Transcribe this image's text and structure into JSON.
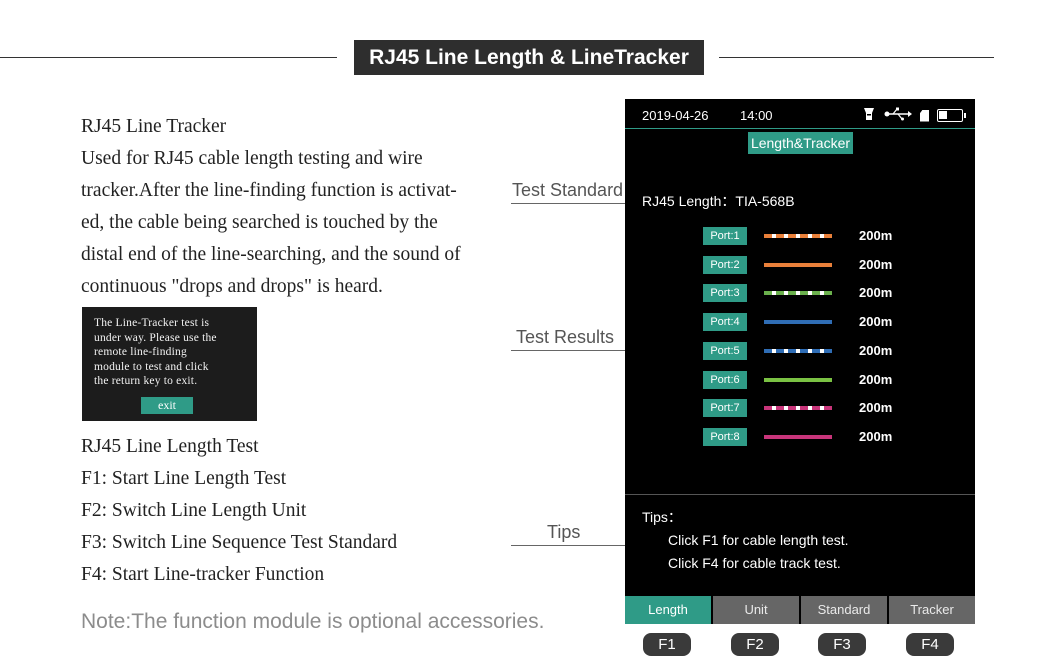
{
  "header": {
    "title": "RJ45 Line Length & LineTracker"
  },
  "description": {
    "lines": [
      "RJ45 Line Tracker",
      "Used for RJ45 cable length testing and wire",
      "tracker.After the line-finding function is activat-",
      "ed, the cable being searched is touched by the",
      "distal end of the line-searching, and the sound of",
      "continuous \"drops and drops\" is heard."
    ]
  },
  "popup": {
    "text": "The Line-Tracker test is\nunder way. Please use the\nremote line-finding\nmodule to test and click\nthe return key to exit.",
    "exit_label": "exit"
  },
  "functions": {
    "lines": [
      "RJ45 Line Length Test",
      "F1: Start Line Length Test",
      "F2: Switch Line Length Unit",
      "F3: Switch Line Sequence Test Standard",
      "F4: Start Line-tracker Function"
    ]
  },
  "note": "Note:The function module is optional accessories.",
  "callouts": {
    "standard": "Test Standard",
    "results": "Test Results",
    "tips": "Tips"
  },
  "screen": {
    "date": "2019-04-26",
    "time": "14:00",
    "icons": [
      "flashlight-icon",
      "usb-icon",
      "sd-card-icon",
      "battery-icon"
    ],
    "battery_level": 0.4,
    "mode_title": "Length&Tracker",
    "standard": "RJ45 Length：TIA-568B",
    "ports": [
      {
        "label": "Port:1",
        "length": "200m",
        "color": "#e9803a",
        "striped": true
      },
      {
        "label": "Port:2",
        "length": "200m",
        "color": "#e9803a",
        "striped": false
      },
      {
        "label": "Port:3",
        "length": "200m",
        "color": "#6ab04c",
        "striped": true
      },
      {
        "label": "Port:4",
        "length": "200m",
        "color": "#2f6db5",
        "striped": false
      },
      {
        "label": "Port:5",
        "length": "200m",
        "color": "#2f6db5",
        "striped": true
      },
      {
        "label": "Port:6",
        "length": "200m",
        "color": "#7ac143",
        "striped": false
      },
      {
        "label": "Port:7",
        "length": "200m",
        "color": "#c8357a",
        "striped": true
      },
      {
        "label": "Port:8",
        "length": "200m",
        "color": "#c8357a",
        "striped": false
      }
    ],
    "tips_heading": "Tips：",
    "tips": [
      "Click F1 for cable length test.",
      "Click F4 for cable track test."
    ],
    "softkeys": [
      "Length",
      "Unit",
      "Standard",
      "Tracker"
    ],
    "hardkeys": [
      "F1",
      "F2",
      "F3",
      "F4"
    ],
    "colors": {
      "accent": "#2f9b87",
      "screen_bg": "#000000",
      "softkey_bg": "#666666"
    }
  }
}
